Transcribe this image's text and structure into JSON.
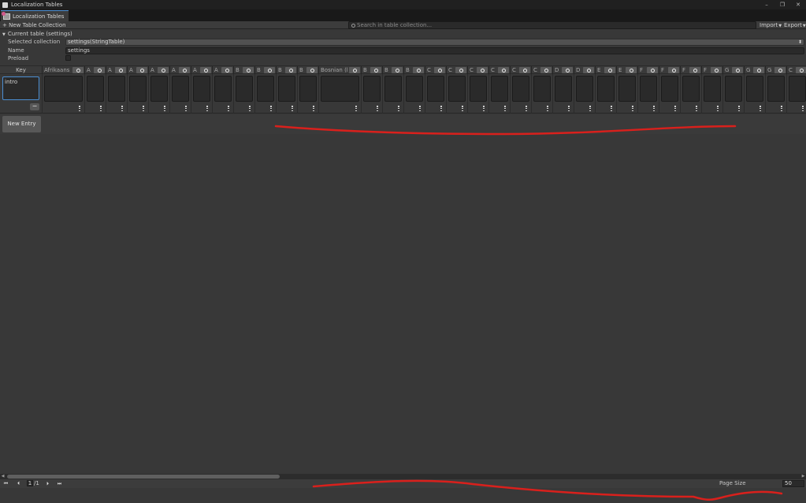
{
  "window": {
    "title": "Localization Tables",
    "minimize": "–",
    "restore": "❐",
    "close": "✕"
  },
  "tab": {
    "label": "Localization Tables"
  },
  "toolbar": {
    "new_collection": "+ New Table Collection",
    "search_placeholder": "Search in table collection...",
    "import_label": "Import",
    "export_label": "Export"
  },
  "current_table": {
    "label": "Current table (settings)",
    "selected_collection_label": "Selected collection",
    "selected_collection_value": "settings(StringTable)",
    "name_label": "Name",
    "name_value": "settings",
    "preload_label": "Preload"
  },
  "table": {
    "key_header": "Key",
    "columns": [
      {
        "label": "Afrikaans",
        "wide": true
      },
      {
        "label": "A",
        "wide": false
      },
      {
        "label": "A",
        "wide": false
      },
      {
        "label": "A",
        "wide": false
      },
      {
        "label": "A",
        "wide": false
      },
      {
        "label": "A",
        "wide": false
      },
      {
        "label": "A",
        "wide": false
      },
      {
        "label": "A",
        "wide": false
      },
      {
        "label": "B",
        "wide": false
      },
      {
        "label": "B",
        "wide": false
      },
      {
        "label": "B",
        "wide": false
      },
      {
        "label": "B",
        "wide": false
      },
      {
        "label": "Bosnian (l",
        "wide": true
      },
      {
        "label": "B",
        "wide": false
      },
      {
        "label": "B",
        "wide": false
      },
      {
        "label": "B",
        "wide": false
      },
      {
        "label": "C",
        "wide": false
      },
      {
        "label": "C",
        "wide": false
      },
      {
        "label": "C",
        "wide": false
      },
      {
        "label": "C",
        "wide": false
      },
      {
        "label": "C",
        "wide": false
      },
      {
        "label": "C",
        "wide": false
      },
      {
        "label": "D",
        "wide": false
      },
      {
        "label": "D",
        "wide": false
      },
      {
        "label": "E",
        "wide": false
      },
      {
        "label": "E",
        "wide": false
      },
      {
        "label": "F",
        "wide": false
      },
      {
        "label": "F",
        "wide": false
      },
      {
        "label": "F",
        "wide": false
      },
      {
        "label": "F",
        "wide": false
      },
      {
        "label": "G",
        "wide": false
      },
      {
        "label": "G",
        "wide": false
      },
      {
        "label": "G",
        "wide": false
      },
      {
        "label": "C",
        "wide": false
      }
    ],
    "rows": [
      {
        "key": "intro",
        "remove_label": "−"
      }
    ],
    "new_entry_label": "New Entry"
  },
  "pagination": {
    "current_page": "1",
    "total_pages": "/1",
    "page_size_label": "Page Size",
    "page_size_value": "50"
  },
  "colors": {
    "background": "#383838",
    "input": "#2a2a2a",
    "accent": "#4b8ed1",
    "annotation": "#d9201c"
  }
}
